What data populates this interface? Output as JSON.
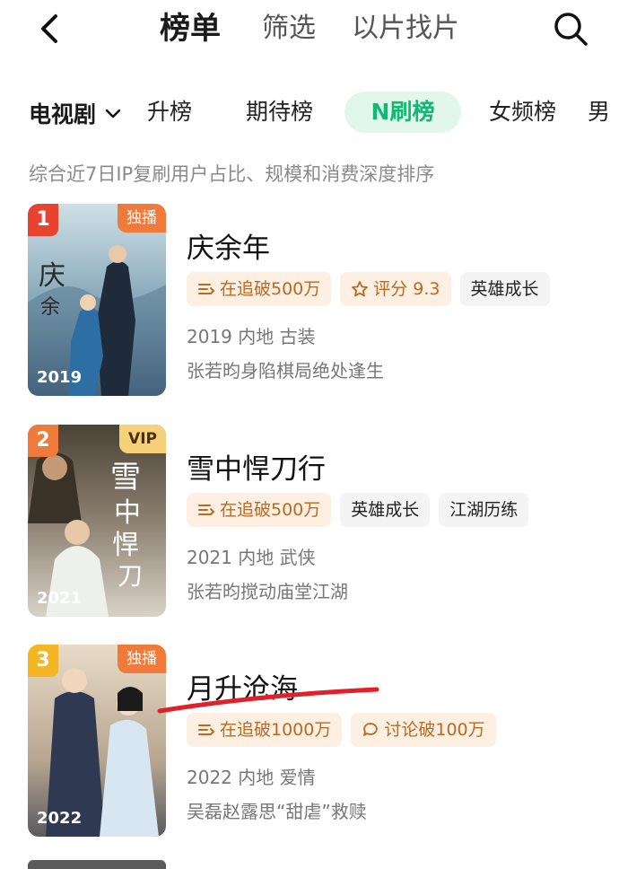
{
  "nav": {
    "active_tab": "榜单",
    "tabs": [
      "筛选",
      "以片找片"
    ]
  },
  "category": {
    "selected": "电视剧"
  },
  "rank_tabs": [
    "升榜",
    "期待榜",
    "N刷榜",
    "女频榜",
    "男"
  ],
  "description": "综合近7日IP复刷用户占比、规模和消费深度排序",
  "items": [
    {
      "rank": "1",
      "badge": "独播",
      "year": "2019",
      "title": "庆余年",
      "chips": [
        "在追破500万",
        "评分 9.3",
        "英雄成长"
      ],
      "meta": "2019 内地 古装",
      "sub": "张若昀身陷棋局绝处逢生"
    },
    {
      "rank": "2",
      "badge": "VIP",
      "year": "2021",
      "title": "雪中悍刀行",
      "chips": [
        "在追破500万",
        "英雄成长",
        "江湖历练"
      ],
      "meta": "2021 内地 武侠",
      "sub": "张若昀搅动庙堂江湖"
    },
    {
      "rank": "3",
      "badge": "独播",
      "year": "2022",
      "title": "月升沧海",
      "chips": [
        "在追破1000万",
        "讨论破100万"
      ],
      "meta": "2022 内地 爱情",
      "sub": "吴磊赵露思“甜虐”救赎"
    }
  ],
  "colors": {
    "accent_green": "#12b876",
    "rank1": "#e8432f",
    "rank2": "#f07a3a",
    "rank3": "#f5b623",
    "underline_red": "#e0202a"
  },
  "icons": [
    "back-icon",
    "search-icon",
    "chevron-down-icon",
    "list-icon",
    "star-icon",
    "comment-icon"
  ]
}
